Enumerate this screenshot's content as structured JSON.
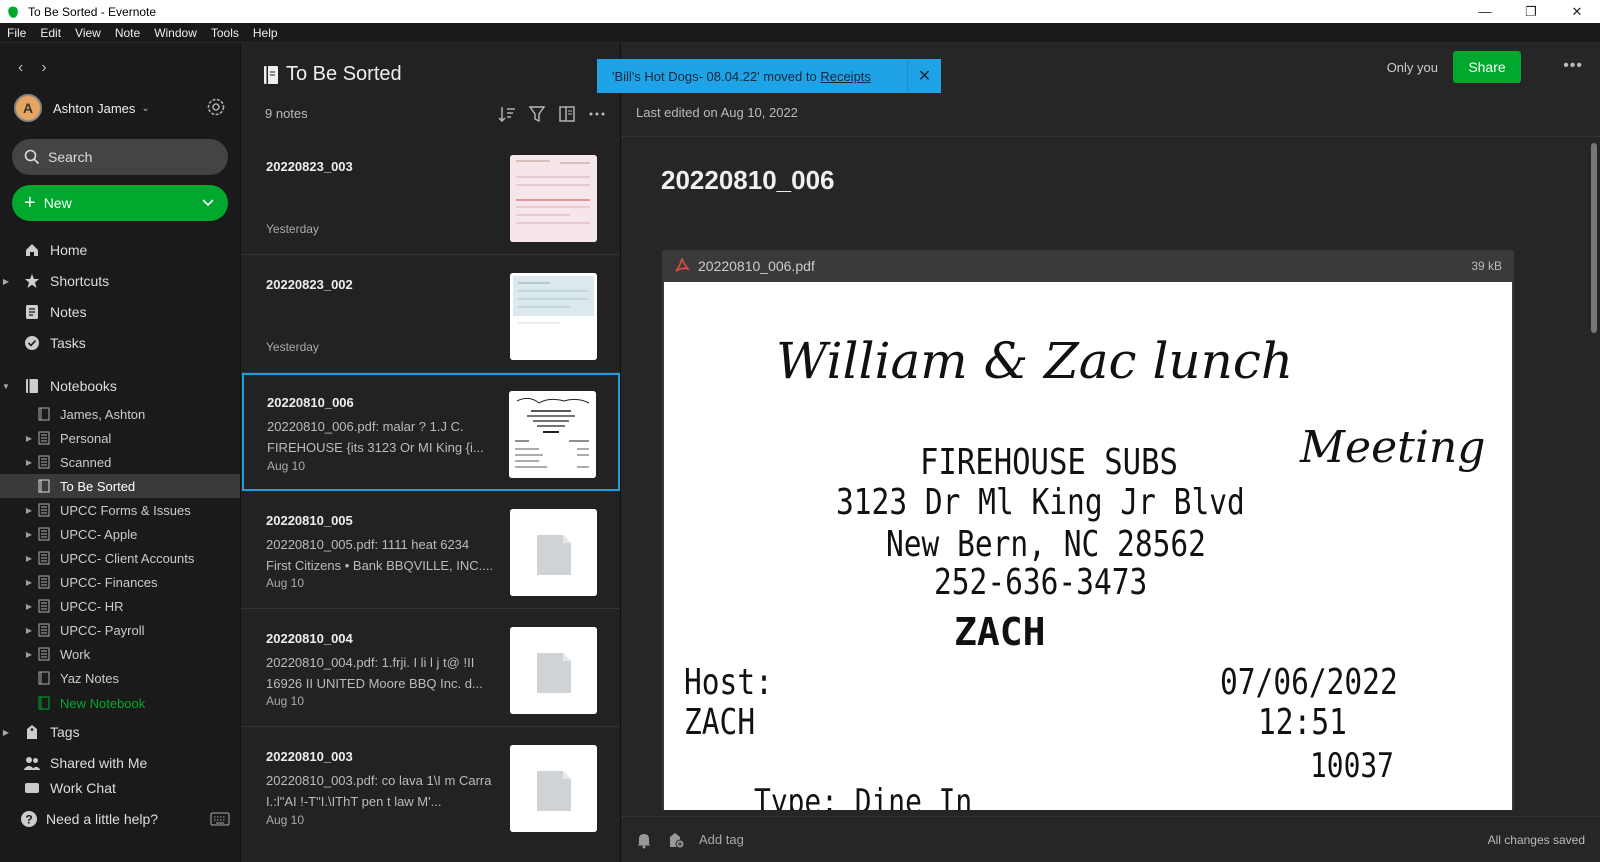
{
  "window": {
    "title": "To Be Sorted - Evernote",
    "minimize": "—",
    "restore": "❐",
    "close": "✕"
  },
  "menu": [
    "File",
    "Edit",
    "View",
    "Note",
    "Window",
    "Tools",
    "Help"
  ],
  "sidebar": {
    "user_name": "Ashton James",
    "avatar_letter": "A",
    "search_placeholder": "Search",
    "new_label": "New",
    "nav": {
      "home": "Home",
      "shortcuts": "Shortcuts",
      "notes": "Notes",
      "tasks": "Tasks",
      "notebooks": "Notebooks",
      "tags": "Tags",
      "shared": "Shared with Me",
      "workchat": "Work Chat"
    },
    "notebooks": [
      "James, Ashton",
      "Personal",
      "Scanned",
      "To Be Sorted",
      "UPCC Forms & Issues",
      "UPCC- Apple",
      "UPCC- Client Accounts",
      "UPCC- Finances",
      "UPCC- HR",
      "UPCC- Payroll",
      "Work",
      "Yaz Notes"
    ],
    "new_notebook": "New Notebook",
    "help": "Need a little help?"
  },
  "notelist": {
    "title": "To Be Sorted",
    "count": "9 notes",
    "notes": [
      {
        "title": "20220823_003",
        "snippet": "",
        "date": "Yesterday"
      },
      {
        "title": "20220823_002",
        "snippet": "",
        "date": "Yesterday"
      },
      {
        "title": "20220810_006",
        "snippet": "20220810_006.pdf: malar ? 1.J C. FIREHOUSE {its 3123 Or MI King {i...",
        "date": "Aug 10"
      },
      {
        "title": "20220810_005",
        "snippet": "20220810_005.pdf: 1111 heat 6234 First Citizens • Bank BBQVILLE, INC....",
        "date": "Aug 10"
      },
      {
        "title": "20220810_004",
        "snippet": "20220810_004.pdf: 1.frji. I li l j t@ !II 16926 II UNITED Moore BBQ Inc. d...",
        "date": "Aug 10"
      },
      {
        "title": "20220810_003",
        "snippet": "20220810_003.pdf: co lava 1\\I m Carra I.:l\"AI !-T\"I.\\IThT pen t law M'...",
        "date": "Aug 10"
      }
    ]
  },
  "toast": {
    "prefix": "'Bill's Hot Dogs- 08.04.22' moved to ",
    "link": "Receipts",
    "close": "✕"
  },
  "editor": {
    "last_edited": "Last edited on Aug 10, 2022",
    "visibility": "Only you",
    "share_label": "Share",
    "note_title": "20220810_006",
    "attachment": {
      "filename": "20220810_006.pdf",
      "size": "39 kB"
    },
    "receipt": {
      "handwriting_line1": "William & Zac lunch",
      "handwriting_line2": "Meeting",
      "store": "FIREHOUSE SUBS",
      "address": "3123 Dr Ml King Jr Blvd",
      "city": "New Bern, NC 28562",
      "phone": "252-636-3473",
      "name": "ZACH",
      "host_label": "Host:",
      "host_name": "ZACH",
      "date": "07/06/2022",
      "time": "12:51",
      "ticket": "10037",
      "order_type": "Type: Dine In"
    },
    "add_tag": "Add tag",
    "save_status": "All changes saved"
  }
}
